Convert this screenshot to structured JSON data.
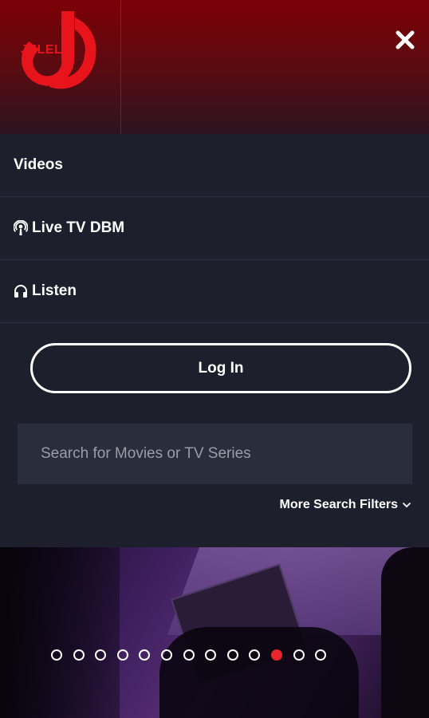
{
  "header": {
    "logo_text": "JELELE",
    "brand_color": "#e8141c"
  },
  "menu": {
    "items": [
      {
        "label": "Videos",
        "icon": null
      },
      {
        "label": "Live TV DBM",
        "icon": "podcast-icon"
      },
      {
        "label": "Listen",
        "icon": "headphones-icon"
      }
    ]
  },
  "login": {
    "label": "Log In"
  },
  "search": {
    "placeholder": "Search for Movies or TV Series",
    "value": ""
  },
  "filters": {
    "label": "More Search Filters"
  },
  "carousel": {
    "dot_count": 13,
    "active_index": 10,
    "active_color": "#e8252c"
  }
}
